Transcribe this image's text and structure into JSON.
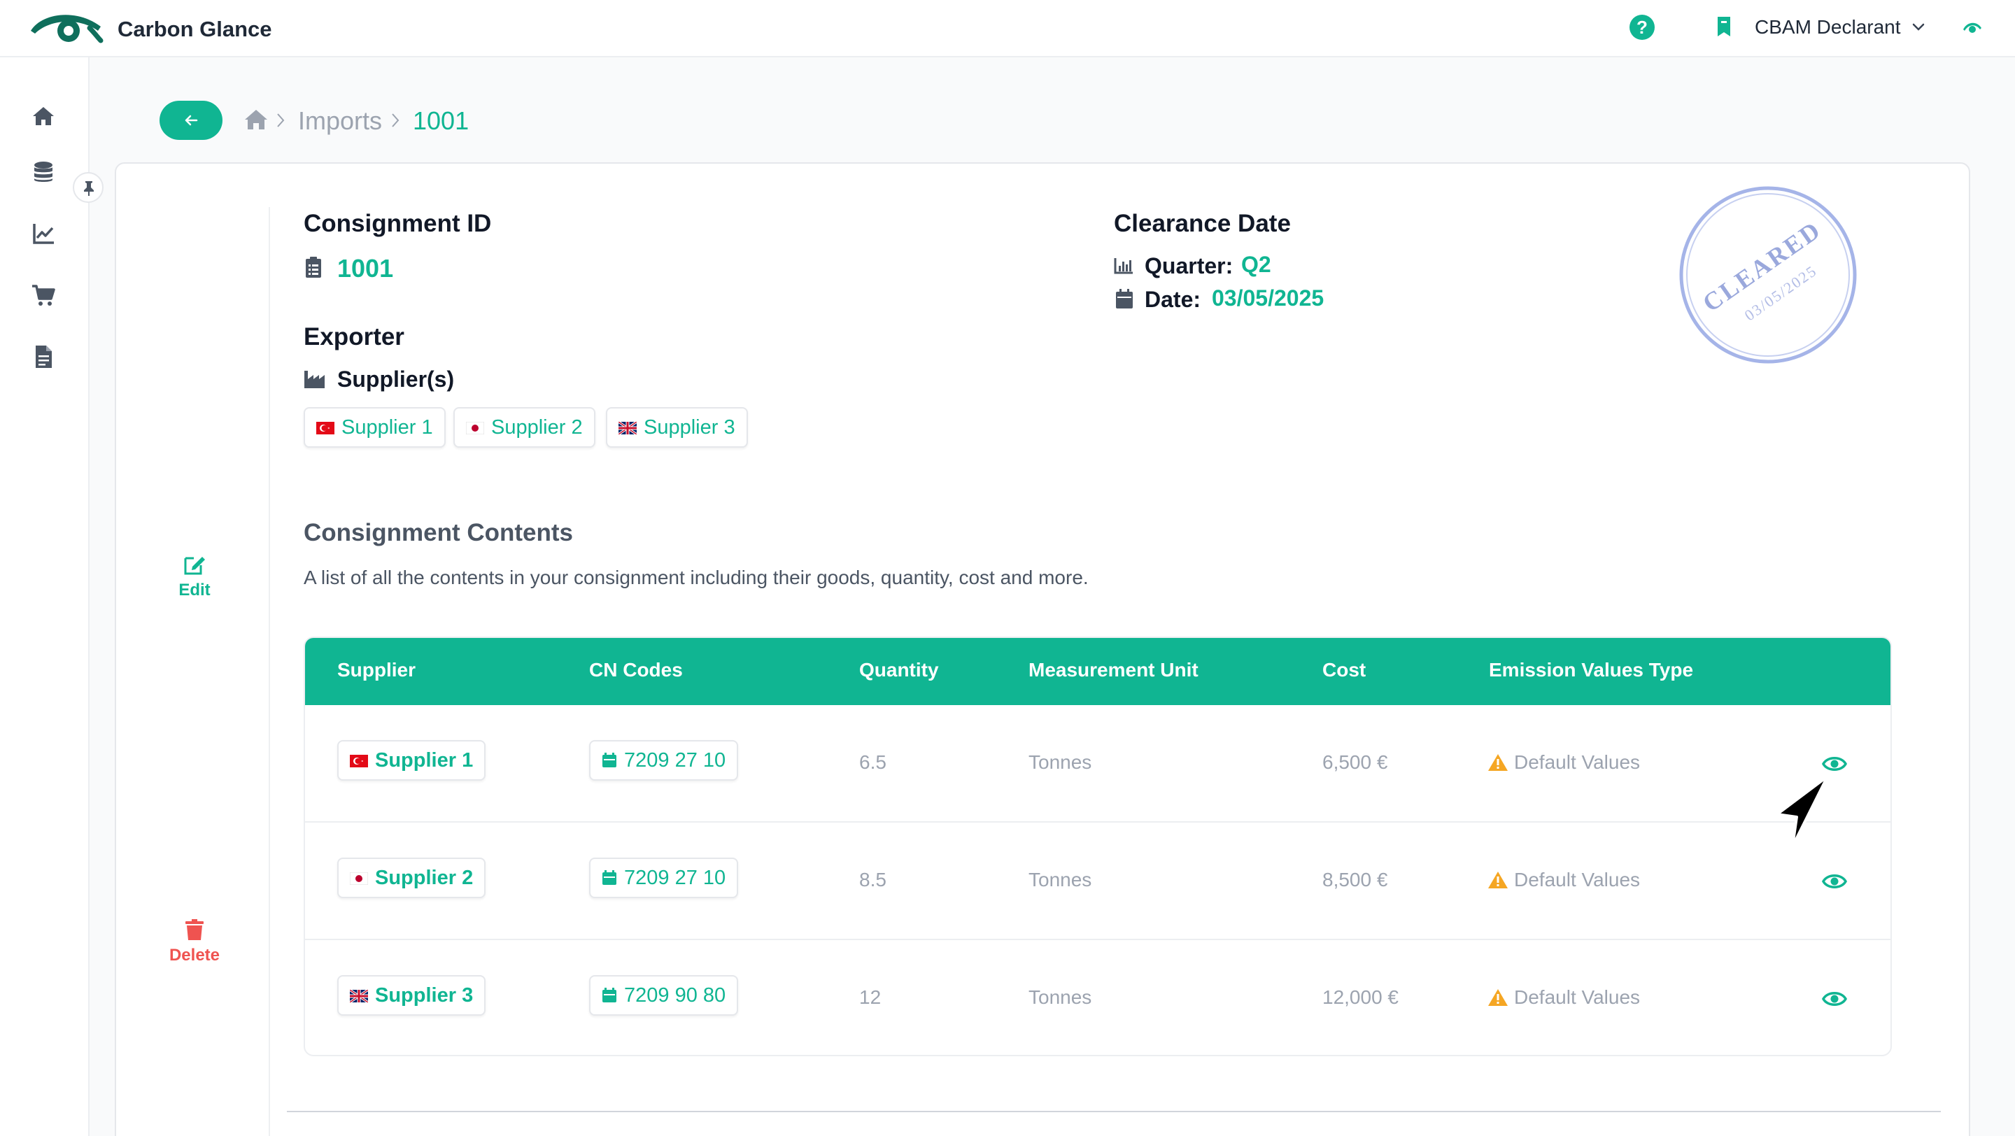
{
  "app": {
    "brand_name": "Carbon Glance",
    "accent_color": "#10b592"
  },
  "header": {
    "help_icon": "question-circle-icon",
    "help_glyph": "?",
    "role_label": "CBAM Declarant",
    "role_icon": "bookmark-icon"
  },
  "sidebar": {
    "items": [
      {
        "icon": "home-icon"
      },
      {
        "icon": "database-icon"
      },
      {
        "icon": "chart-line-icon"
      },
      {
        "icon": "shopping-cart-icon"
      },
      {
        "icon": "document-icon"
      }
    ],
    "pin_icon": "pin-icon"
  },
  "breadcrumb": {
    "items": [
      "Imports",
      "1001"
    ]
  },
  "actions": {
    "edit_label": "Edit",
    "delete_label": "Delete"
  },
  "consignment": {
    "id_label": "Consignment ID",
    "id_value": "1001",
    "exporter_label": "Exporter",
    "suppliers_label": "Supplier(s)",
    "suppliers": [
      {
        "name": "Supplier 1",
        "flag": "TR"
      },
      {
        "name": "Supplier 2",
        "flag": "JP"
      },
      {
        "name": "Supplier 3",
        "flag": "GB"
      }
    ],
    "clearance_label": "Clearance Date",
    "quarter_label": "Quarter:",
    "quarter_value": "Q2",
    "date_label": "Date:",
    "date_value": "03/05/2025"
  },
  "stamp": {
    "text": "CLEARED",
    "date": "03/05/2025",
    "color": "#a5b4e8"
  },
  "contents": {
    "title": "Consignment Contents",
    "description": "A list of all the contents in your consignment including their goods, quantity, cost and more.",
    "columns": [
      "Supplier",
      "CN Codes",
      "Quantity",
      "Measurement Unit",
      "Cost",
      "Emission Values Type"
    ],
    "rows": [
      {
        "supplier": "Supplier 1",
        "flag": "TR",
        "cn_code": "7209 27 10",
        "quantity": "6.5",
        "unit": "Tonnes",
        "cost": "6,500 €",
        "emission": "Default Values"
      },
      {
        "supplier": "Supplier 2",
        "flag": "JP",
        "cn_code": "7209 27 10",
        "quantity": "8.5",
        "unit": "Tonnes",
        "cost": "8,500 €",
        "emission": "Default Values"
      },
      {
        "supplier": "Supplier 3",
        "flag": "GB",
        "cn_code": "7209 90 80",
        "quantity": "12",
        "unit": "Tonnes",
        "cost": "12,000 €",
        "emission": "Default Values"
      }
    ]
  }
}
